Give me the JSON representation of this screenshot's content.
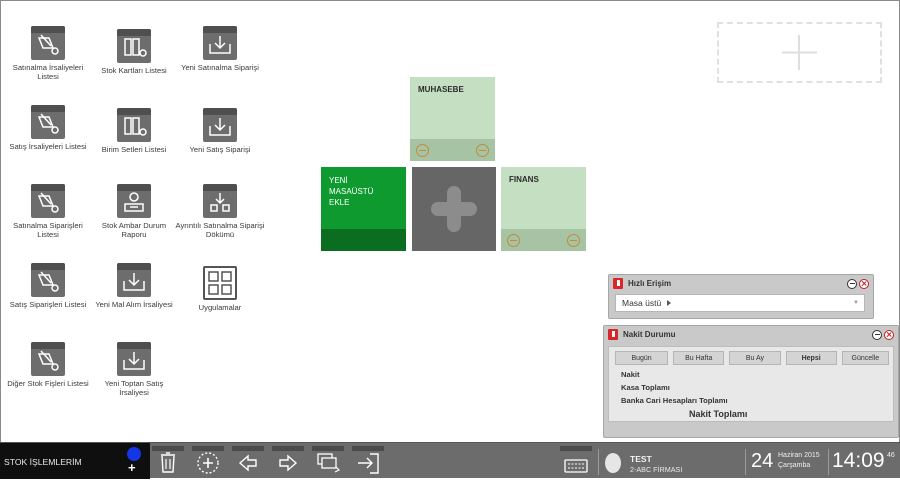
{
  "shortcuts": [
    {
      "label": "Satınalma İrsaliyeleri Listesi",
      "icon": "documents-arrow-icon"
    },
    {
      "label": "Stok Kartları Listesi",
      "icon": "stock-cards-icon"
    },
    {
      "label": "Yeni Satınalma Siparişi",
      "icon": "inbox-tray-icon"
    },
    {
      "label": "Satış İrsaliyeleri Listesi",
      "icon": "documents-arrow-icon"
    },
    {
      "label": "Birim Setleri Listesi",
      "icon": "stock-cards-icon"
    },
    {
      "label": "Yeni Satış Siparişi",
      "icon": "inbox-tray-icon"
    },
    {
      "label": "Satınalma Siparişleri Listesi",
      "icon": "documents-arrow-icon"
    },
    {
      "label": "Stok Ambar Durum Raporu",
      "icon": "warehouse-report-icon"
    },
    {
      "label": "Ayrıntılı Satınalma Siparişi Dökümü",
      "icon": "detailed-report-icon"
    },
    {
      "label": "Satış Siparişleri Listesi",
      "icon": "documents-arrow-icon"
    },
    {
      "label": "Yeni Mal Alım İrsaliyesi",
      "icon": "inbox-tray-icon"
    },
    {
      "label": "Uygulamalar",
      "icon": "applications-icon"
    },
    {
      "label": "Diğer Stok Fişleri Listesi",
      "icon": "documents-arrow-icon"
    },
    {
      "label": "Yeni Toptan Satış İrsaliyesi",
      "icon": "inbox-tray-icon"
    }
  ],
  "tiles": {
    "muhasebe": "MUHASEBE",
    "new_desktop": "YENİ MASAÜSTÜ EKLE",
    "finans": "FINANS"
  },
  "quick_access": {
    "title": "Hızlı Erişim",
    "selected": "Masa üstü"
  },
  "cash_status": {
    "title": "Nakit Durumu",
    "buttons": [
      "Bugün",
      "Bu Hafta",
      "Bu Ay",
      "Hepsi",
      "Güncelle"
    ],
    "lines": [
      "Nakit",
      "Kasa Toplamı",
      "Banka Cari Hesapları Toplamı"
    ],
    "total_label": "Nakit Toplamı"
  },
  "taskbar": {
    "module": "STOK İŞLEMLERİM",
    "user": "TEST",
    "company": "2-ABC FİRMASI",
    "day": "24",
    "month_year": "Haziran 2015",
    "weekday": "Çarşamba",
    "time": "14:09",
    "seconds": "46"
  },
  "colors": {
    "green_tile": "#0f9a2f",
    "light_green": "#c4dfc2",
    "gray_tile": "#666666",
    "taskbar": "#6c6c6c"
  }
}
